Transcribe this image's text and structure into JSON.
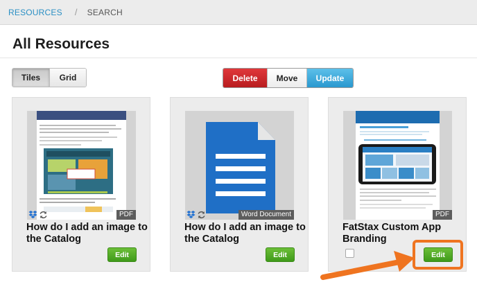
{
  "breadcrumb": {
    "root": "RESOURCES",
    "current": "SEARCH"
  },
  "page": {
    "title": "All Resources"
  },
  "view_toggle": {
    "tiles": "Tiles",
    "grid": "Grid",
    "active": "Tiles"
  },
  "actions": {
    "delete": "Delete",
    "move": "Move",
    "update": "Update"
  },
  "cards": [
    {
      "title": "How do I add an image to the Catalog",
      "type": "PDF",
      "edit": "Edit",
      "synced": true
    },
    {
      "title": "How do I add an image to the Catalog",
      "type": "Word Document",
      "edit": "Edit",
      "synced": true
    },
    {
      "title": "FatStax Custom App Branding",
      "type": "PDF",
      "edit": "Edit",
      "synced": false
    }
  ],
  "thumb1": {
    "header": "How do I add an image to the Catalog Branding Page?",
    "callout1": "Your Many Interesting Marketing",
    "callout2": "Are You Missing?"
  },
  "thumb3": {
    "brand": "FATSTAX",
    "heading": "Custom App Branding Elements",
    "subheading": "iPad Brandable Page Elements • FatStax App"
  },
  "colors": {
    "accent_blue": "#2a8fc4",
    "delete_red": "#c8272a",
    "update_blue": "#3aa8dc",
    "edit_green": "#4fa826",
    "highlight_orange": "#ef7420"
  }
}
